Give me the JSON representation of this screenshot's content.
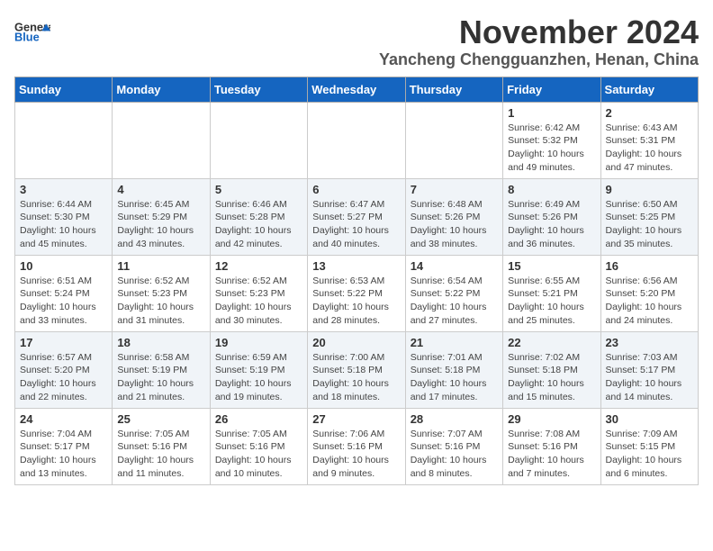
{
  "header": {
    "logo_general": "General",
    "logo_blue": "Blue",
    "month": "November 2024",
    "location": "Yancheng Chengguanzhen, Henan, China"
  },
  "days_of_week": [
    "Sunday",
    "Monday",
    "Tuesday",
    "Wednesday",
    "Thursday",
    "Friday",
    "Saturday"
  ],
  "weeks": [
    [
      {
        "day": "",
        "info": ""
      },
      {
        "day": "",
        "info": ""
      },
      {
        "day": "",
        "info": ""
      },
      {
        "day": "",
        "info": ""
      },
      {
        "day": "",
        "info": ""
      },
      {
        "day": "1",
        "info": "Sunrise: 6:42 AM\nSunset: 5:32 PM\nDaylight: 10 hours\nand 49 minutes."
      },
      {
        "day": "2",
        "info": "Sunrise: 6:43 AM\nSunset: 5:31 PM\nDaylight: 10 hours\nand 47 minutes."
      }
    ],
    [
      {
        "day": "3",
        "info": "Sunrise: 6:44 AM\nSunset: 5:30 PM\nDaylight: 10 hours\nand 45 minutes."
      },
      {
        "day": "4",
        "info": "Sunrise: 6:45 AM\nSunset: 5:29 PM\nDaylight: 10 hours\nand 43 minutes."
      },
      {
        "day": "5",
        "info": "Sunrise: 6:46 AM\nSunset: 5:28 PM\nDaylight: 10 hours\nand 42 minutes."
      },
      {
        "day": "6",
        "info": "Sunrise: 6:47 AM\nSunset: 5:27 PM\nDaylight: 10 hours\nand 40 minutes."
      },
      {
        "day": "7",
        "info": "Sunrise: 6:48 AM\nSunset: 5:26 PM\nDaylight: 10 hours\nand 38 minutes."
      },
      {
        "day": "8",
        "info": "Sunrise: 6:49 AM\nSunset: 5:26 PM\nDaylight: 10 hours\nand 36 minutes."
      },
      {
        "day": "9",
        "info": "Sunrise: 6:50 AM\nSunset: 5:25 PM\nDaylight: 10 hours\nand 35 minutes."
      }
    ],
    [
      {
        "day": "10",
        "info": "Sunrise: 6:51 AM\nSunset: 5:24 PM\nDaylight: 10 hours\nand 33 minutes."
      },
      {
        "day": "11",
        "info": "Sunrise: 6:52 AM\nSunset: 5:23 PM\nDaylight: 10 hours\nand 31 minutes."
      },
      {
        "day": "12",
        "info": "Sunrise: 6:52 AM\nSunset: 5:23 PM\nDaylight: 10 hours\nand 30 minutes."
      },
      {
        "day": "13",
        "info": "Sunrise: 6:53 AM\nSunset: 5:22 PM\nDaylight: 10 hours\nand 28 minutes."
      },
      {
        "day": "14",
        "info": "Sunrise: 6:54 AM\nSunset: 5:22 PM\nDaylight: 10 hours\nand 27 minutes."
      },
      {
        "day": "15",
        "info": "Sunrise: 6:55 AM\nSunset: 5:21 PM\nDaylight: 10 hours\nand 25 minutes."
      },
      {
        "day": "16",
        "info": "Sunrise: 6:56 AM\nSunset: 5:20 PM\nDaylight: 10 hours\nand 24 minutes."
      }
    ],
    [
      {
        "day": "17",
        "info": "Sunrise: 6:57 AM\nSunset: 5:20 PM\nDaylight: 10 hours\nand 22 minutes."
      },
      {
        "day": "18",
        "info": "Sunrise: 6:58 AM\nSunset: 5:19 PM\nDaylight: 10 hours\nand 21 minutes."
      },
      {
        "day": "19",
        "info": "Sunrise: 6:59 AM\nSunset: 5:19 PM\nDaylight: 10 hours\nand 19 minutes."
      },
      {
        "day": "20",
        "info": "Sunrise: 7:00 AM\nSunset: 5:18 PM\nDaylight: 10 hours\nand 18 minutes."
      },
      {
        "day": "21",
        "info": "Sunrise: 7:01 AM\nSunset: 5:18 PM\nDaylight: 10 hours\nand 17 minutes."
      },
      {
        "day": "22",
        "info": "Sunrise: 7:02 AM\nSunset: 5:18 PM\nDaylight: 10 hours\nand 15 minutes."
      },
      {
        "day": "23",
        "info": "Sunrise: 7:03 AM\nSunset: 5:17 PM\nDaylight: 10 hours\nand 14 minutes."
      }
    ],
    [
      {
        "day": "24",
        "info": "Sunrise: 7:04 AM\nSunset: 5:17 PM\nDaylight: 10 hours\nand 13 minutes."
      },
      {
        "day": "25",
        "info": "Sunrise: 7:05 AM\nSunset: 5:16 PM\nDaylight: 10 hours\nand 11 minutes."
      },
      {
        "day": "26",
        "info": "Sunrise: 7:05 AM\nSunset: 5:16 PM\nDaylight: 10 hours\nand 10 minutes."
      },
      {
        "day": "27",
        "info": "Sunrise: 7:06 AM\nSunset: 5:16 PM\nDaylight: 10 hours\nand 9 minutes."
      },
      {
        "day": "28",
        "info": "Sunrise: 7:07 AM\nSunset: 5:16 PM\nDaylight: 10 hours\nand 8 minutes."
      },
      {
        "day": "29",
        "info": "Sunrise: 7:08 AM\nSunset: 5:16 PM\nDaylight: 10 hours\nand 7 minutes."
      },
      {
        "day": "30",
        "info": "Sunrise: 7:09 AM\nSunset: 5:15 PM\nDaylight: 10 hours\nand 6 minutes."
      }
    ]
  ]
}
